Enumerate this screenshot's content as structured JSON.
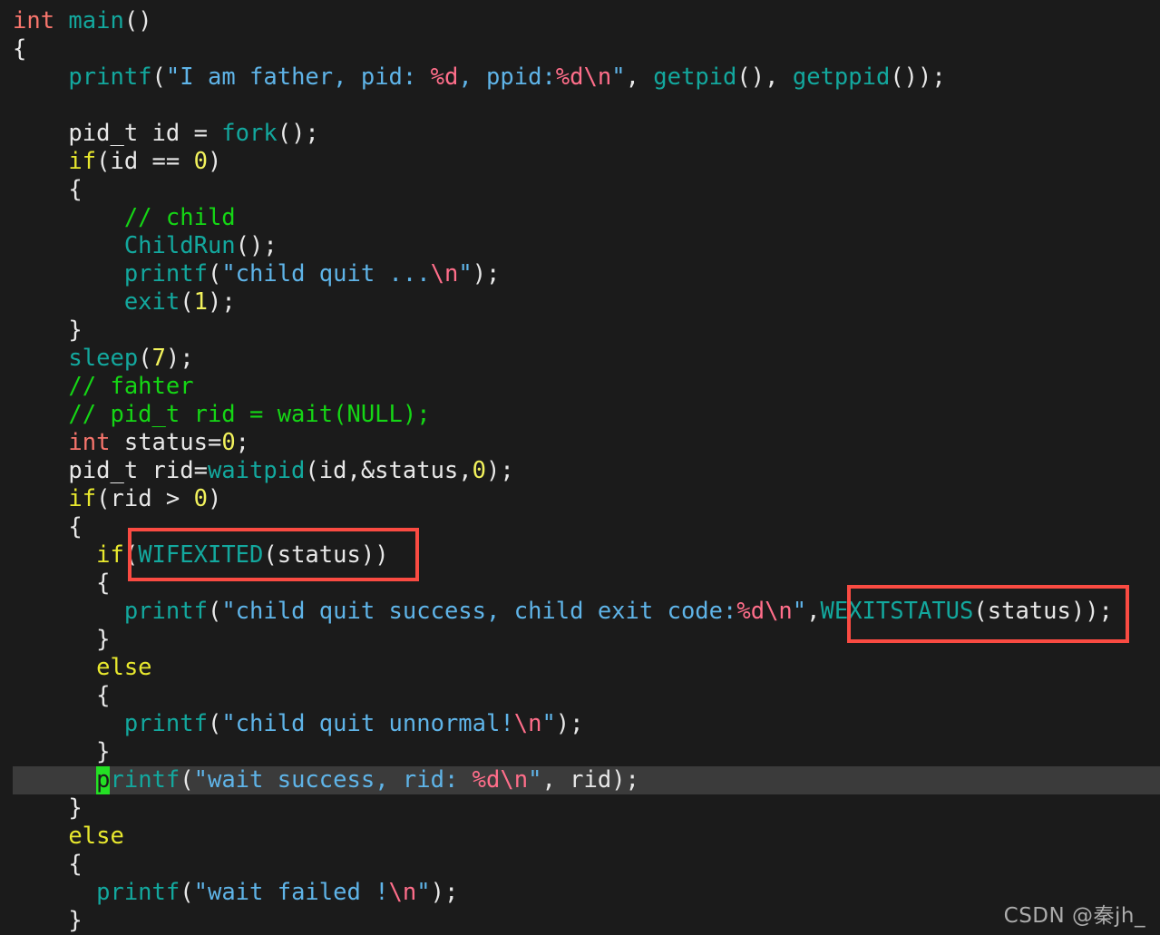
{
  "editor": {
    "background_color": "#1b1b1b",
    "cursor_line_color": "#3b3b3b",
    "cursor_block_color": "#24e024",
    "annotation_box_color": "#fa4b42",
    "language": "C"
  },
  "colors": {
    "keyword_type": "#f7756c",
    "keyword_control": "#e8e82e",
    "function": "#13a89e",
    "string": "#5fb4e8",
    "escape": "#ff6e8a",
    "number": "#f2f25c",
    "comment": "#15d615",
    "plain": "#e8e8e8"
  },
  "code": {
    "lines": [
      {
        "n": 1,
        "tokens": [
          {
            "t": "int",
            "c": "kw"
          },
          {
            "t": " ",
            "c": "plain"
          },
          {
            "t": "main",
            "c": "fn"
          },
          {
            "t": "()",
            "c": "plain"
          }
        ]
      },
      {
        "n": 2,
        "tokens": [
          {
            "t": "{",
            "c": "plain"
          }
        ]
      },
      {
        "n": 3,
        "tokens": [
          {
            "t": "    ",
            "c": "plain"
          },
          {
            "t": "printf",
            "c": "fn"
          },
          {
            "t": "(",
            "c": "plain"
          },
          {
            "t": "\"I am father, pid: ",
            "c": "str"
          },
          {
            "t": "%d",
            "c": "esc"
          },
          {
            "t": ", ppid:",
            "c": "str"
          },
          {
            "t": "%d\\n",
            "c": "esc"
          },
          {
            "t": "\"",
            "c": "str"
          },
          {
            "t": ", ",
            "c": "plain"
          },
          {
            "t": "getpid",
            "c": "fn"
          },
          {
            "t": "(), ",
            "c": "plain"
          },
          {
            "t": "getppid",
            "c": "fn"
          },
          {
            "t": "());",
            "c": "plain"
          }
        ]
      },
      {
        "n": 4,
        "tokens": []
      },
      {
        "n": 5,
        "tokens": [
          {
            "t": "    pid_t id = ",
            "c": "plain"
          },
          {
            "t": "fork",
            "c": "fn"
          },
          {
            "t": "();",
            "c": "plain"
          }
        ]
      },
      {
        "n": 6,
        "tokens": [
          {
            "t": "    ",
            "c": "plain"
          },
          {
            "t": "if",
            "c": "ctrl"
          },
          {
            "t": "(id == ",
            "c": "plain"
          },
          {
            "t": "0",
            "c": "num"
          },
          {
            "t": ")",
            "c": "plain"
          }
        ]
      },
      {
        "n": 7,
        "tokens": [
          {
            "t": "    {",
            "c": "plain"
          }
        ]
      },
      {
        "n": 8,
        "tokens": [
          {
            "t": "        ",
            "c": "plain"
          },
          {
            "t": "// child",
            "c": "cmt"
          }
        ]
      },
      {
        "n": 9,
        "tokens": [
          {
            "t": "        ",
            "c": "plain"
          },
          {
            "t": "ChildRun",
            "c": "fn"
          },
          {
            "t": "();",
            "c": "plain"
          }
        ]
      },
      {
        "n": 10,
        "tokens": [
          {
            "t": "        ",
            "c": "plain"
          },
          {
            "t": "printf",
            "c": "fn"
          },
          {
            "t": "(",
            "c": "plain"
          },
          {
            "t": "\"child quit ...",
            "c": "str"
          },
          {
            "t": "\\n",
            "c": "esc"
          },
          {
            "t": "\"",
            "c": "str"
          },
          {
            "t": ");",
            "c": "plain"
          }
        ]
      },
      {
        "n": 11,
        "tokens": [
          {
            "t": "        ",
            "c": "plain"
          },
          {
            "t": "exit",
            "c": "fn"
          },
          {
            "t": "(",
            "c": "plain"
          },
          {
            "t": "1",
            "c": "num"
          },
          {
            "t": ");",
            "c": "plain"
          }
        ]
      },
      {
        "n": 12,
        "tokens": [
          {
            "t": "    }",
            "c": "plain"
          }
        ]
      },
      {
        "n": 13,
        "tokens": [
          {
            "t": "    ",
            "c": "plain"
          },
          {
            "t": "sleep",
            "c": "fn"
          },
          {
            "t": "(",
            "c": "plain"
          },
          {
            "t": "7",
            "c": "num"
          },
          {
            "t": ");",
            "c": "plain"
          }
        ]
      },
      {
        "n": 14,
        "tokens": [
          {
            "t": "    ",
            "c": "plain"
          },
          {
            "t": "// fahter",
            "c": "cmt"
          }
        ]
      },
      {
        "n": 15,
        "tokens": [
          {
            "t": "    ",
            "c": "plain"
          },
          {
            "t": "// pid_t rid = wait(NULL);",
            "c": "cmt"
          }
        ]
      },
      {
        "n": 16,
        "tokens": [
          {
            "t": "    ",
            "c": "plain"
          },
          {
            "t": "int",
            "c": "kw"
          },
          {
            "t": " status=",
            "c": "plain"
          },
          {
            "t": "0",
            "c": "num"
          },
          {
            "t": ";",
            "c": "plain"
          }
        ]
      },
      {
        "n": 17,
        "tokens": [
          {
            "t": "    pid_t rid=",
            "c": "plain"
          },
          {
            "t": "waitpid",
            "c": "fn"
          },
          {
            "t": "(id,&status,",
            "c": "plain"
          },
          {
            "t": "0",
            "c": "num"
          },
          {
            "t": ");",
            "c": "plain"
          }
        ]
      },
      {
        "n": 18,
        "tokens": [
          {
            "t": "    ",
            "c": "plain"
          },
          {
            "t": "if",
            "c": "ctrl"
          },
          {
            "t": "(rid > ",
            "c": "plain"
          },
          {
            "t": "0",
            "c": "num"
          },
          {
            "t": ")",
            "c": "plain"
          }
        ]
      },
      {
        "n": 19,
        "tokens": [
          {
            "t": "    {",
            "c": "plain"
          }
        ]
      },
      {
        "n": 20,
        "tokens": [
          {
            "t": "      ",
            "c": "plain"
          },
          {
            "t": "if",
            "c": "ctrl"
          },
          {
            "t": "(",
            "c": "plain"
          },
          {
            "t": "WIFEXITED",
            "c": "fn"
          },
          {
            "t": "(status))",
            "c": "plain"
          }
        ]
      },
      {
        "n": 21,
        "tokens": [
          {
            "t": "      {",
            "c": "plain"
          }
        ]
      },
      {
        "n": 22,
        "tokens": [
          {
            "t": "        ",
            "c": "plain"
          },
          {
            "t": "printf",
            "c": "fn"
          },
          {
            "t": "(",
            "c": "plain"
          },
          {
            "t": "\"child quit success, child exit code:",
            "c": "str"
          },
          {
            "t": "%d\\n",
            "c": "esc"
          },
          {
            "t": "\"",
            "c": "str"
          },
          {
            "t": ",",
            "c": "plain"
          },
          {
            "t": "WEXITSTATUS",
            "c": "fn"
          },
          {
            "t": "(status));",
            "c": "plain"
          }
        ]
      },
      {
        "n": 23,
        "tokens": [
          {
            "t": "      }",
            "c": "plain"
          }
        ]
      },
      {
        "n": 24,
        "tokens": [
          {
            "t": "      ",
            "c": "plain"
          },
          {
            "t": "else",
            "c": "ctrl"
          }
        ]
      },
      {
        "n": 25,
        "tokens": [
          {
            "t": "      {",
            "c": "plain"
          }
        ]
      },
      {
        "n": 26,
        "tokens": [
          {
            "t": "        ",
            "c": "plain"
          },
          {
            "t": "printf",
            "c": "fn"
          },
          {
            "t": "(",
            "c": "plain"
          },
          {
            "t": "\"child quit unnormal!",
            "c": "str"
          },
          {
            "t": "\\n",
            "c": "esc"
          },
          {
            "t": "\"",
            "c": "str"
          },
          {
            "t": ");",
            "c": "plain"
          }
        ]
      },
      {
        "n": 27,
        "tokens": [
          {
            "t": "      }",
            "c": "plain"
          }
        ]
      },
      {
        "n": 28,
        "cursor_line": true,
        "cursor_at": 6,
        "tokens": [
          {
            "t": "      ",
            "c": "plain"
          },
          {
            "t": "p",
            "c": "cursor"
          },
          {
            "t": "rintf",
            "c": "fn"
          },
          {
            "t": "(",
            "c": "plain"
          },
          {
            "t": "\"wait success, rid: ",
            "c": "str"
          },
          {
            "t": "%d\\n",
            "c": "esc"
          },
          {
            "t": "\"",
            "c": "str"
          },
          {
            "t": ", rid);",
            "c": "plain"
          }
        ]
      },
      {
        "n": 29,
        "tokens": [
          {
            "t": "    }",
            "c": "plain"
          }
        ]
      },
      {
        "n": 30,
        "tokens": [
          {
            "t": "    ",
            "c": "plain"
          },
          {
            "t": "else",
            "c": "ctrl"
          }
        ]
      },
      {
        "n": 31,
        "tokens": [
          {
            "t": "    {",
            "c": "plain"
          }
        ]
      },
      {
        "n": 32,
        "tokens": [
          {
            "t": "      ",
            "c": "plain"
          },
          {
            "t": "printf",
            "c": "fn"
          },
          {
            "t": "(",
            "c": "plain"
          },
          {
            "t": "\"wait failed !",
            "c": "str"
          },
          {
            "t": "\\n",
            "c": "esc"
          },
          {
            "t": "\"",
            "c": "str"
          },
          {
            "t": ");",
            "c": "plain"
          }
        ]
      },
      {
        "n": 33,
        "tokens": [
          {
            "t": "    }",
            "c": "plain"
          }
        ]
      }
    ]
  },
  "annotations": [
    {
      "id": "annot-box-wifexited",
      "target_text": "(WIFEXITED(status))",
      "color": "#fa4b42"
    },
    {
      "id": "annot-box-wexitstatus",
      "target_text": "WEXITSTATUS(status)",
      "color": "#fa4b42"
    }
  ],
  "watermark": {
    "text": "CSDN @秦jh_"
  }
}
